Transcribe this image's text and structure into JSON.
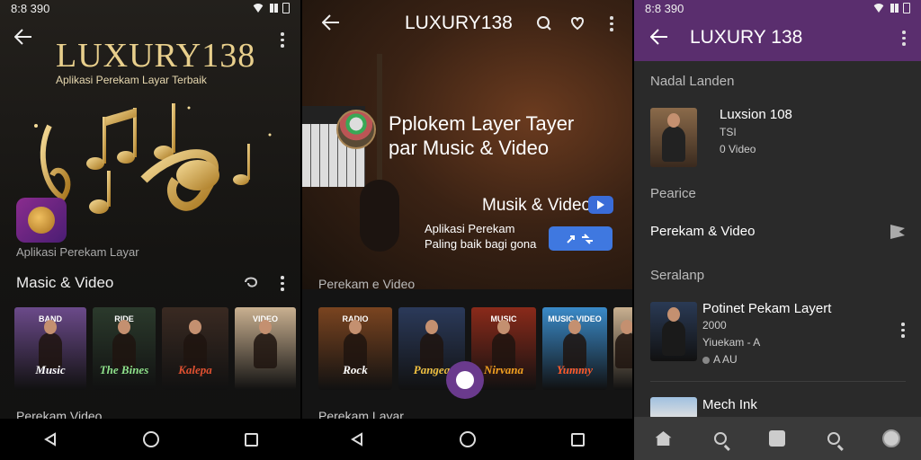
{
  "panel1": {
    "status_time": "8:8 390",
    "title": "LUXURY138",
    "subtitle": "Aplikasi Perekam Layar Terbaik",
    "app_name": "Aplikasi Perekam Layar",
    "section1_title": "Masic & Video",
    "thumbs": [
      {
        "title": "BAND",
        "label": "Music",
        "bg": "#6b4a8a",
        "color": "#ffffff"
      },
      {
        "title": "RIDE",
        "label": "The Bines",
        "bg": "#2b3a2c",
        "color": "#8ee08a"
      },
      {
        "title": "",
        "label": "Kalepa",
        "bg": "#3a2a22",
        "color": "#e05030"
      },
      {
        "title": "VIDEO",
        "label": "",
        "bg": "#c9b090",
        "color": "#ffffff"
      }
    ],
    "section2_title": "Perekam Video"
  },
  "panel2": {
    "title": "LUXURY138",
    "hero_title_line1": "Pplokem Layer Tayer",
    "hero_title_line2": "par Music & Video",
    "music_video": "Musik & Video",
    "desc_line1": "Aplikasi Perekam",
    "desc_line2": "Paling baik bagi gona",
    "section1_title": "Perekam e Video",
    "thumbs": [
      {
        "title": "RADIO",
        "label": "Rock",
        "bg": "#7a4420",
        "color": "#ffffff"
      },
      {
        "title": "",
        "label": "Pangea",
        "bg": "#2b3a5a",
        "color": "#f0c040"
      },
      {
        "title": "MUSIC",
        "label": "Nirvana",
        "bg": "#8a2a1a",
        "color": "#f0a020"
      },
      {
        "title": "MUSIC VIDEO",
        "label": "Yummy",
        "bg": "#3a8ac8",
        "color": "#ff5a2a"
      },
      {
        "title": "",
        "label": "",
        "bg": "#c9b090",
        "color": "#ffffff"
      }
    ],
    "section2_title": "Perekam Layar"
  },
  "panel3": {
    "status_time": "8:8 390",
    "title": "LUXURY 138",
    "label1": "Nadal Landen",
    "item1_title": "Luxsion 108",
    "item1_sub1": "TSI",
    "item1_sub2": "0 Video",
    "label2": "Pearice",
    "row2_text": "Perekam & Video",
    "label3": "Seralanp",
    "item2_title": "Potinet Pekam Layert",
    "item2_sub1": "2000",
    "item2_sub2": "Yiuekam - A",
    "item2_sub3": "A AU",
    "item3_title": "Mech Ink",
    "accent": "#5a2e6e"
  }
}
